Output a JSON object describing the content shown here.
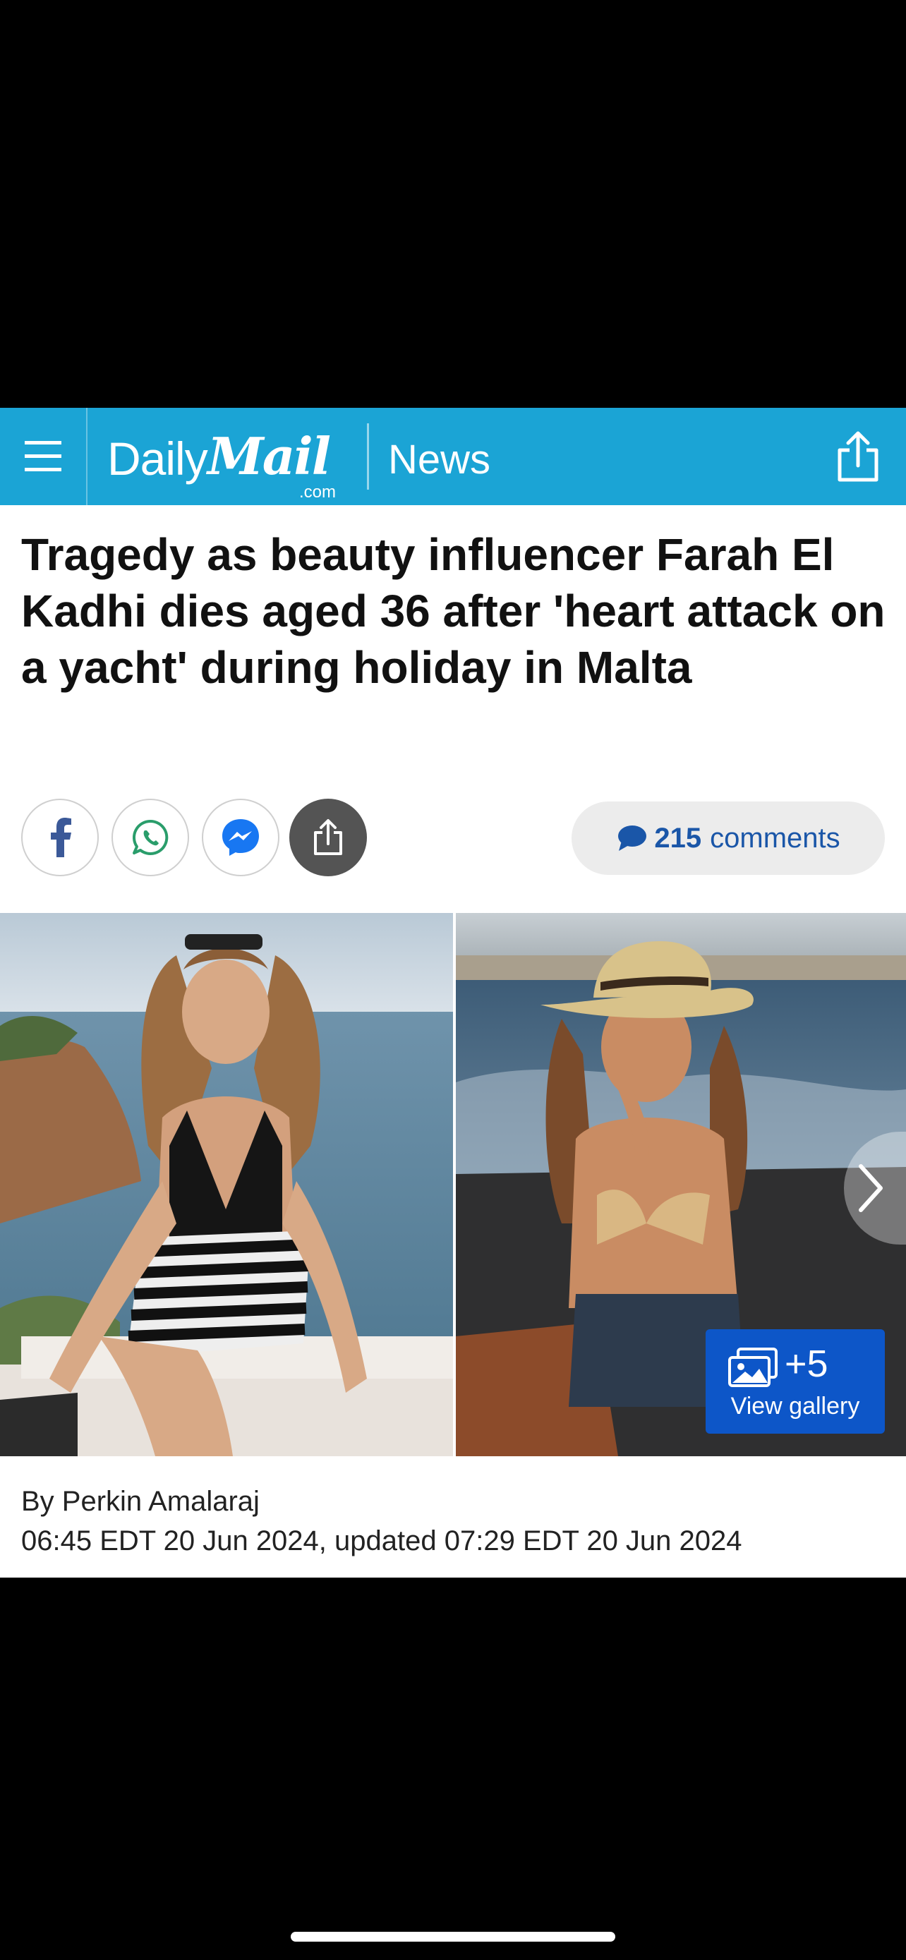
{
  "header": {
    "brand_daily": "Daily",
    "brand_mail": "Mail",
    "brand_com": ".com",
    "section": "News",
    "bg_color": "#1ba4d5"
  },
  "article": {
    "headline": "Tragedy as beauty influencer Farah El Kadhi dies aged 36 after 'heart attack on a yacht' during holiday in Malta",
    "comments_count": "215",
    "comments_label": "comments",
    "gallery": {
      "extra_count": "+5",
      "view_label": "View gallery"
    },
    "byline": "By Perkin Amalaraj",
    "timestamp": "06:45 EDT 20 Jun 2024, updated 07:29 EDT 20 Jun 2024"
  },
  "social": [
    "facebook-icon",
    "whatsapp-icon",
    "messenger-icon",
    "share-icon"
  ],
  "colors": {
    "accent": "#1ba4d5",
    "link": "#1a56a8",
    "gallery_button": "#0d56c8"
  }
}
